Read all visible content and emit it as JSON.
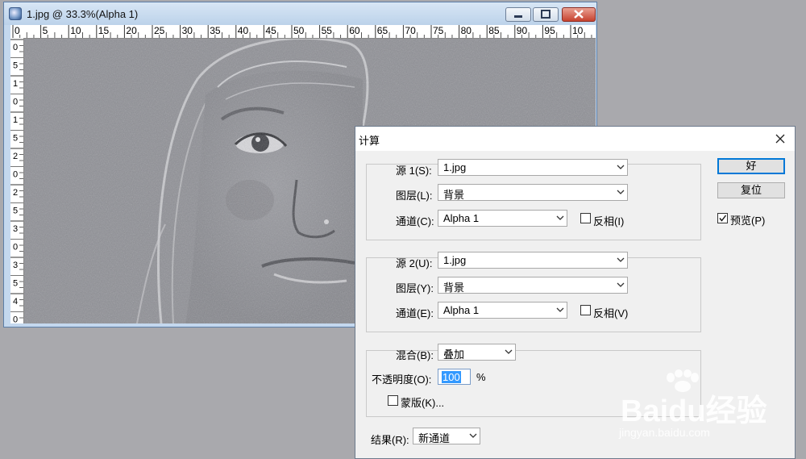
{
  "document_window": {
    "title": "1.jpg @ 33.3%(Alpha 1)",
    "ruler_top_labels": [
      "0",
      "5",
      "10",
      "15",
      "20",
      "25",
      "30",
      "35",
      "40",
      "45",
      "50",
      "55",
      "60",
      "65",
      "70",
      "75",
      "80",
      "85",
      "90",
      "95",
      "10"
    ],
    "ruler_left_labels": [
      "0",
      "5",
      "1",
      "0",
      "1",
      "5",
      "2",
      "0",
      "2",
      "5",
      "3",
      "0",
      "3",
      "5",
      "4",
      "0"
    ]
  },
  "dialog": {
    "title": "计算",
    "source1": {
      "label": "源 1(S):",
      "value": "1.jpg",
      "layer_label": "图层(L):",
      "layer_value": "背景",
      "channel_label": "通道(C):",
      "channel_value": "Alpha 1",
      "invert_label": "反相(I)",
      "invert_checked": false
    },
    "source2": {
      "label": "源 2(U):",
      "value": "1.jpg",
      "layer_label": "图层(Y):",
      "layer_value": "背景",
      "channel_label": "通道(E):",
      "channel_value": "Alpha 1",
      "invert_label": "反相(V)",
      "invert_checked": false
    },
    "blending": {
      "label": "混合(B):",
      "value": "叠加",
      "opacity_label": "不透明度(O):",
      "opacity_value": "100",
      "opacity_unit": "%",
      "mask_label": "蒙版(K)...",
      "mask_checked": false
    },
    "result": {
      "label": "结果(R):",
      "value": "新通道"
    },
    "buttons": {
      "ok": "好",
      "reset": "复位"
    },
    "preview": {
      "label": "预览(P)",
      "checked": true
    }
  },
  "watermark": {
    "brand": "Baidu经验",
    "url": "jingyan.baidu.com"
  }
}
